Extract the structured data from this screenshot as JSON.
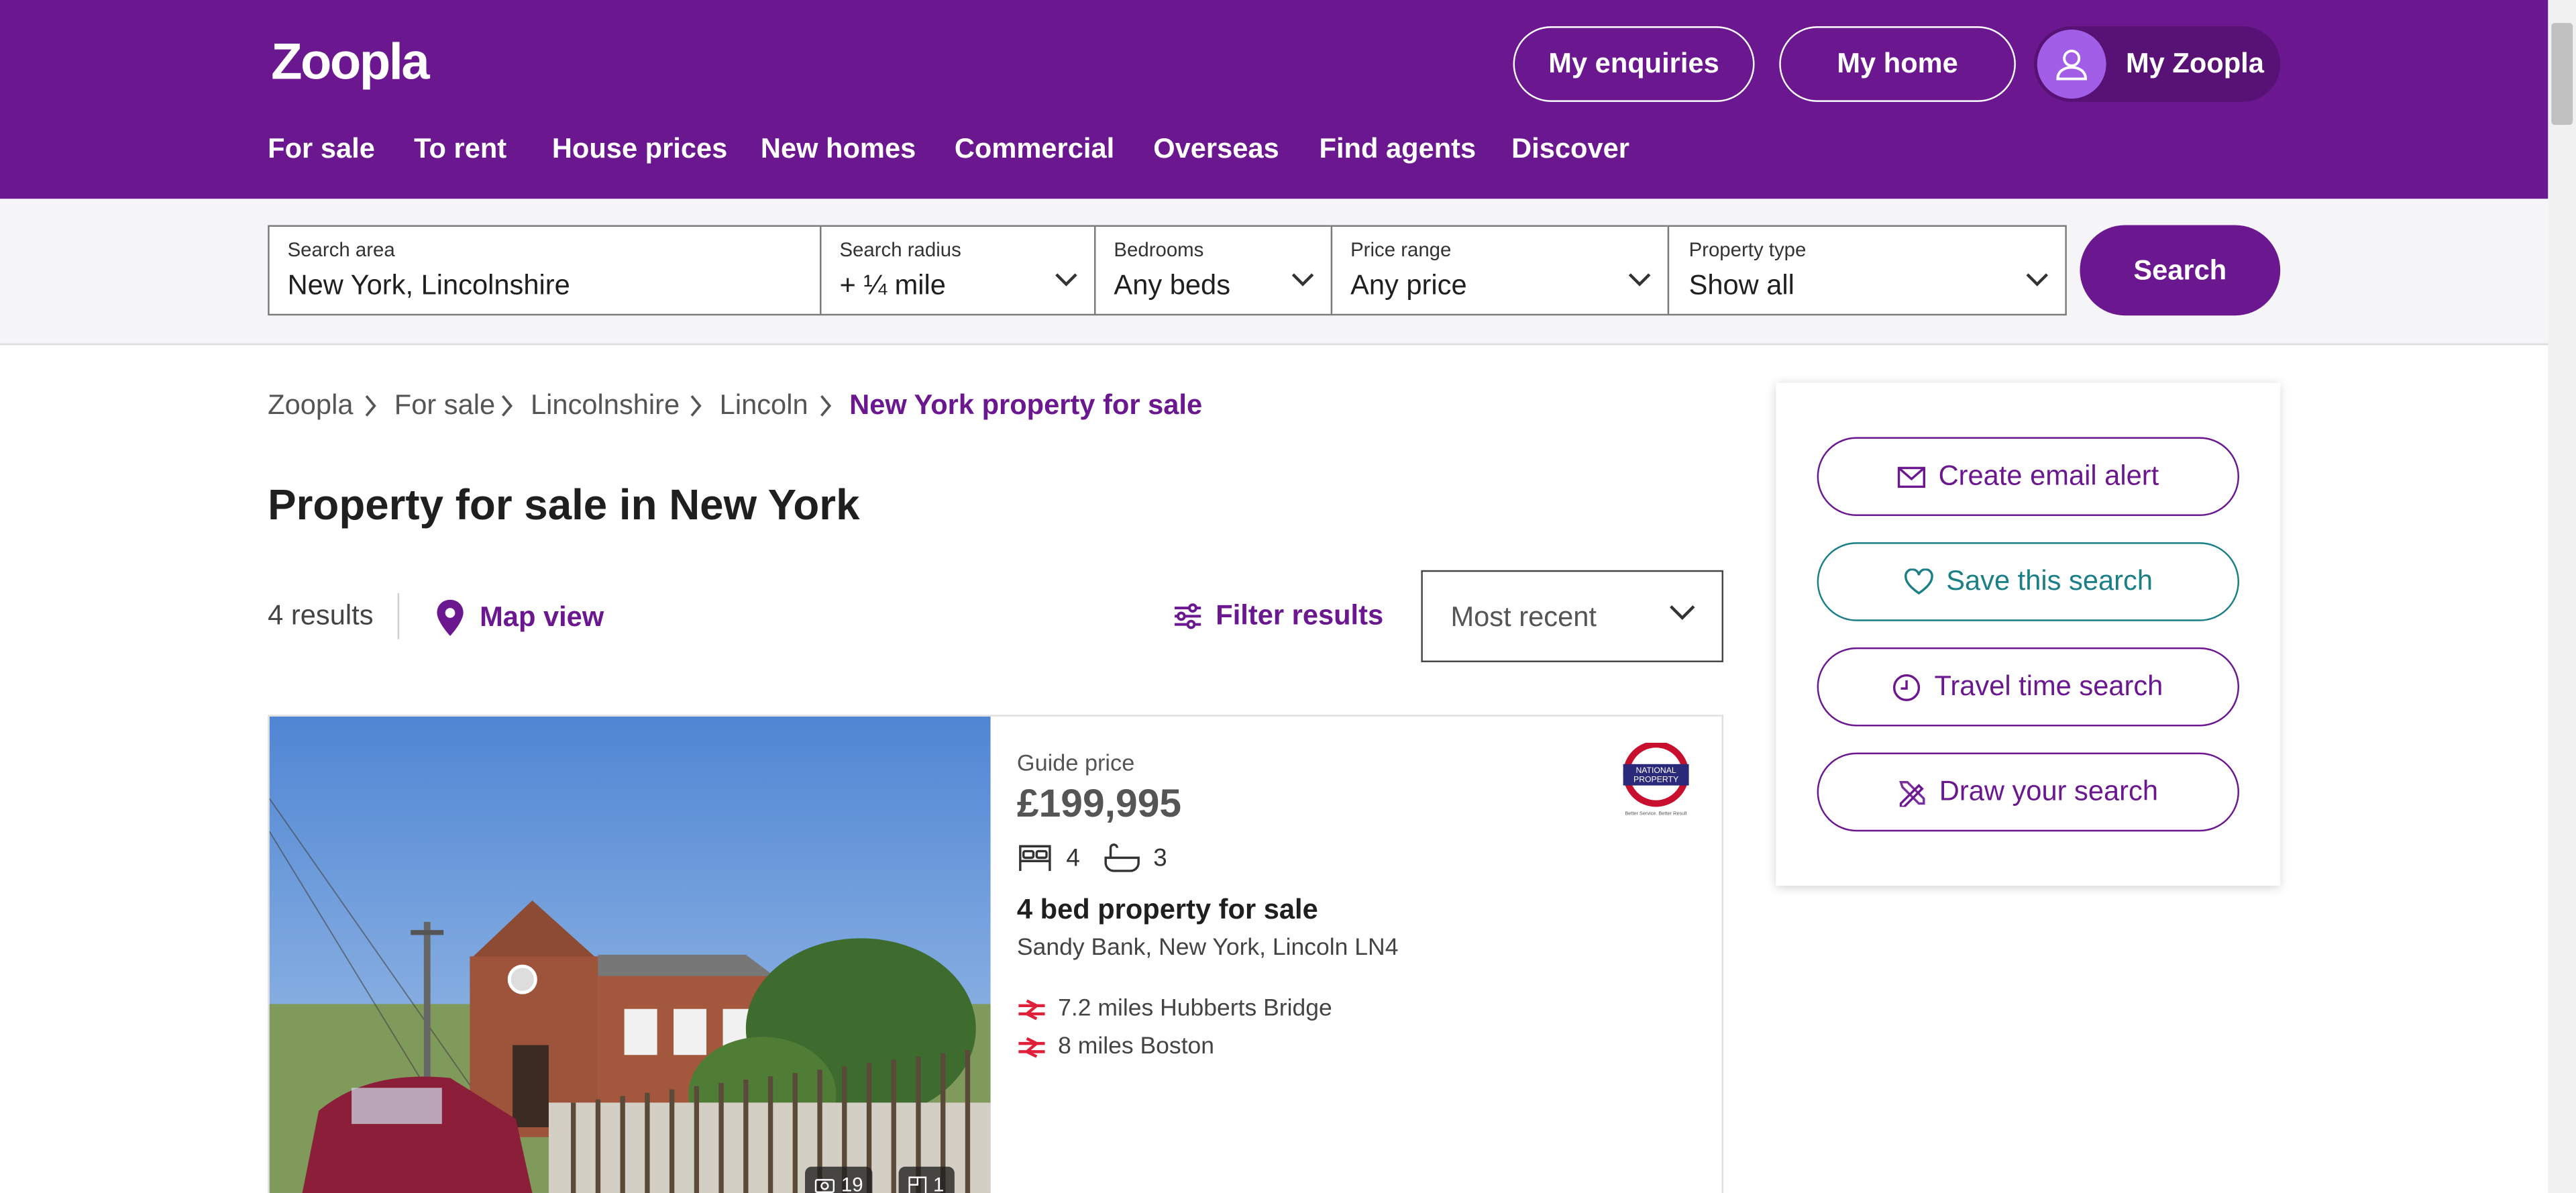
{
  "header": {
    "logo": "Zoopla",
    "my_enquiries": "My enquiries",
    "my_home": "My home",
    "my_zoopla": "My Zoopla",
    "nav": [
      "For sale",
      "To rent",
      "House prices",
      "New homes",
      "Commercial",
      "Overseas",
      "Find agents",
      "Discover"
    ]
  },
  "search": {
    "area_label": "Search area",
    "area_value": "New York, Lincolnshire",
    "radius_label": "Search radius",
    "radius_value": "+ ¼ mile",
    "beds_label": "Bedrooms",
    "beds_value": "Any beds",
    "price_label": "Price range",
    "price_value": "Any price",
    "type_label": "Property type",
    "type_value": "Show all",
    "button": "Search"
  },
  "breadcrumb": [
    "Zoopla",
    "For sale",
    "Lincolnshire",
    "Lincoln",
    "New York property for sale"
  ],
  "page_title": "Property for sale in New York",
  "toolbar": {
    "results": "4 results",
    "map_view": "Map view",
    "filter": "Filter results",
    "sort": "Most recent"
  },
  "listing": {
    "price_label": "Guide price",
    "price": "£199,995",
    "beds": "4",
    "baths": "3",
    "title": "4 bed property for sale",
    "address": "Sandy Bank, New York, Lincoln LN4",
    "stations": [
      "7.2 miles Hubberts Bridge",
      "8 miles Boston"
    ],
    "photo_count": "19",
    "floorplan_count": "1",
    "agent_logo_text": [
      "NATIONAL",
      "PROPERTY",
      "Better Service. Better Result"
    ]
  },
  "side_panel": {
    "email_alert": "Create email alert",
    "save_search": "Save this search",
    "travel_time": "Travel time search",
    "draw_search": "Draw your search"
  },
  "colors": {
    "brand": "#6b1790",
    "teal": "#1a7f86",
    "rail": "#e0203b"
  }
}
